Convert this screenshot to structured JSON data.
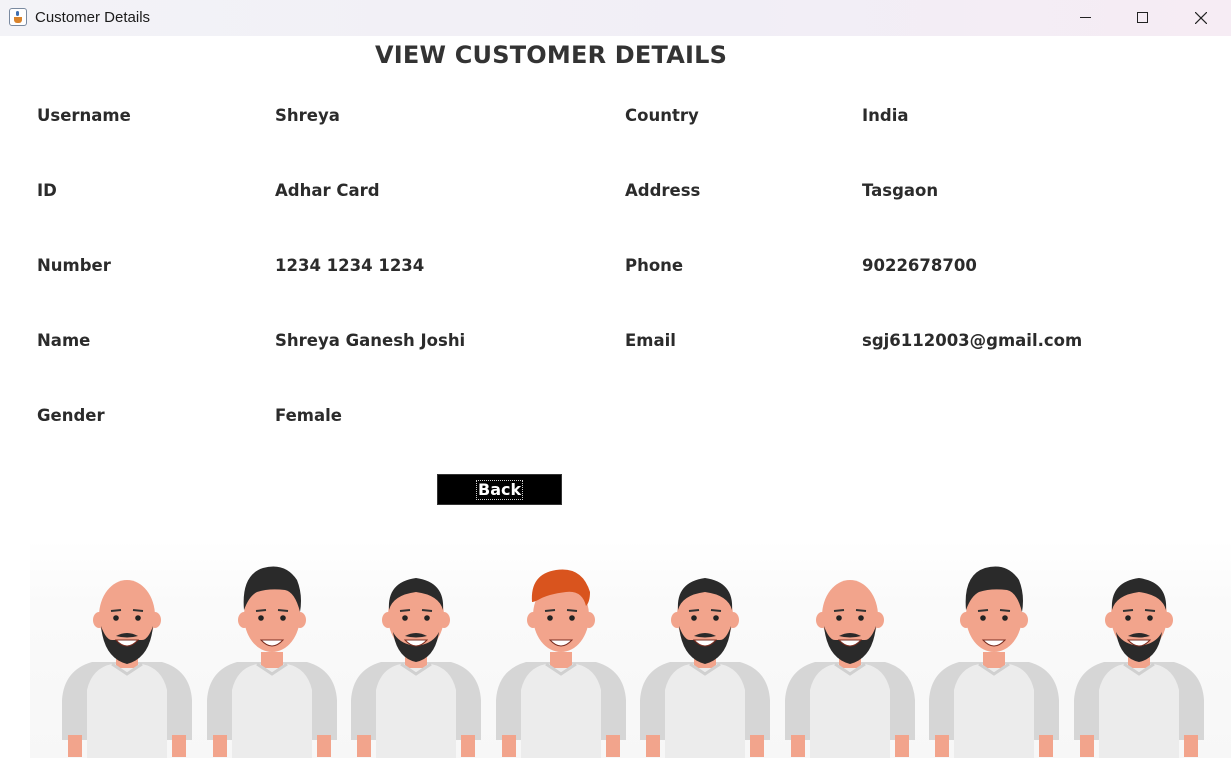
{
  "window": {
    "title": "Customer Details",
    "icon": "java-coffee-icon",
    "controls": [
      "minimize-icon",
      "maximize-icon",
      "close-icon"
    ]
  },
  "page": {
    "title": "VIEW CUSTOMER DETAILS"
  },
  "fields_left": [
    {
      "label": "Username",
      "value": "Shreya"
    },
    {
      "label": "ID",
      "value": "Adhar Card"
    },
    {
      "label": "Number",
      "value": "1234 1234 1234"
    },
    {
      "label": "Name",
      "value": "Shreya Ganesh Joshi"
    },
    {
      "label": "Gender",
      "value": "Female"
    }
  ],
  "fields_right": [
    {
      "label": "Country",
      "value": "India"
    },
    {
      "label": "Address",
      "value": "Tasgaon"
    },
    {
      "label": "Phone",
      "value": "9022678700"
    },
    {
      "label": "Email",
      "value": "sgj6112003@gmail.com"
    }
  ],
  "actions": {
    "back_label": "Back"
  },
  "banner": {
    "people": [
      {
        "hair": "bald",
        "beard": "full"
      },
      {
        "hair": "quiff",
        "beard": "none"
      },
      {
        "hair": "short",
        "beard": "goatee"
      },
      {
        "hair": "ginger",
        "beard": "none"
      },
      {
        "hair": "short",
        "beard": "full-mustache"
      },
      {
        "hair": "bald",
        "beard": "full"
      },
      {
        "hair": "quiff",
        "beard": "none"
      },
      {
        "hair": "short",
        "beard": "goatee"
      }
    ],
    "colors": {
      "skin": "#f2a48c",
      "hair": "#2a2a2a",
      "ginger": "#d9541e",
      "shirt": "#ececec",
      "sleeve": "#d6d6d6"
    }
  }
}
